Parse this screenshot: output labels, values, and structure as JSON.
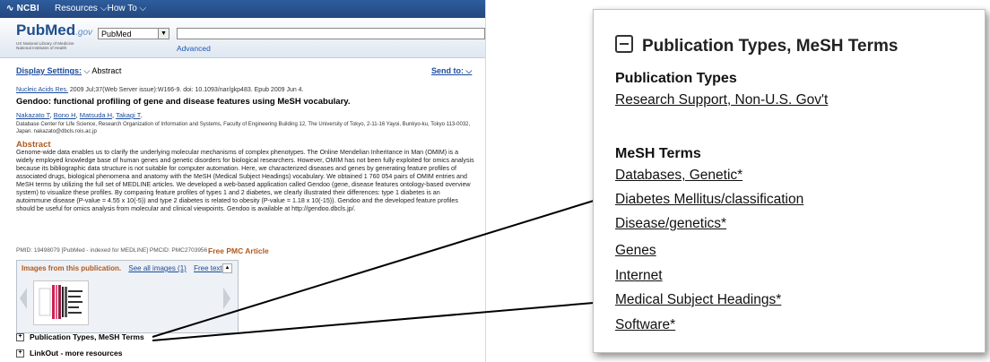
{
  "topbar": {
    "logo": "NCBI",
    "resources": "Resources",
    "howto": "How To"
  },
  "header": {
    "pubmed_logo": "PubMed",
    "pubmed_logo_gov": ".gov",
    "library_line1": "US National Library of Medicine",
    "library_line2": "National Institutes of Health",
    "db_select": "PubMed",
    "advanced": "Advanced"
  },
  "display": {
    "label": "Display Settings:",
    "value": "Abstract",
    "send_to": "Send to:"
  },
  "article": {
    "journal": "Nucleic Acids Res.",
    "citation_rest": " 2009 Jul;37(Web Server issue):W166-9. doi: 10.1093/nar/gkp483. Epub 2009 Jun 4.",
    "title": "Gendoo: functional profiling of gene and disease features using MeSH vocabulary.",
    "authors": [
      "Nakazato T",
      "Bono H",
      "Matsuda H",
      "Takagi T"
    ],
    "affiliation": "Database Center for Life Science, Research Organization of Information and Systems, Faculty of Engineering Building 12, The University of Tokyo, 2-11-16 Yayoi, Bunkyo-ku, Tokyo 113-0032, Japan. nakazato@dbcls.rois.ac.jp",
    "abstract_heading": "Abstract",
    "abstract": "Genome-wide data enables us to clarify the underlying molecular mechanisms of complex phenotypes. The Online Mendelian Inheritance in Man (OMIM) is a widely employed knowledge base of human genes and genetic disorders for biological researchers. However, OMIM has not been fully exploited for omics analysis because its bibliographic data structure is not suitable for computer automation. Here, we characterized diseases and genes by generating feature profiles of associated drugs, biological phenomena and anatomy with the MeSH (Medical Subject Headings) vocabulary. We obtained 1 760 054 pairs of OMIM entries and MeSH terms by utilizing the full set of MEDLINE articles. We developed a web-based application called Gendoo (gene, disease features ontology-based overview system) to visualize these profiles. By comparing feature profiles of types 1 and 2 diabetes, we clearly illustrated their differences: type 1 diabetes is an autoimmune disease (P-value = 4.55 x 10(-5)) and type 2 diabetes is related to obesity (P-value = 1.18 x 10(-15)). Gendoo and the developed feature profiles should be useful for omics analysis from molecular and clinical viewpoints. Gendoo is available at http://gendoo.dbcls.jp/.",
    "pmid_line": "PMID: 19498079 [PubMed - indexed for MEDLINE]   PMCID: PMC2703956",
    "free_pmc": "Free PMC Article"
  },
  "images_box": {
    "heading": "Images from this publication.",
    "see_all": "See all images (1)",
    "free_text": "Free text"
  },
  "sections": {
    "pub_types": "Publication Types, MeSH Terms",
    "linkout": "LinkOut - more resources"
  },
  "zoom": {
    "heading": "Publication Types, MeSH Terms",
    "pub_types_heading": "Publication Types",
    "pub_types": [
      "Research Support, Non-U.S. Gov't"
    ],
    "mesh_heading": "MeSH Terms",
    "mesh_terms": [
      "Databases, Genetic*",
      "Diabetes Mellitus/classification",
      "Disease/genetics*",
      "Genes",
      "Internet",
      "Medical Subject Headings*",
      "Software*"
    ]
  }
}
